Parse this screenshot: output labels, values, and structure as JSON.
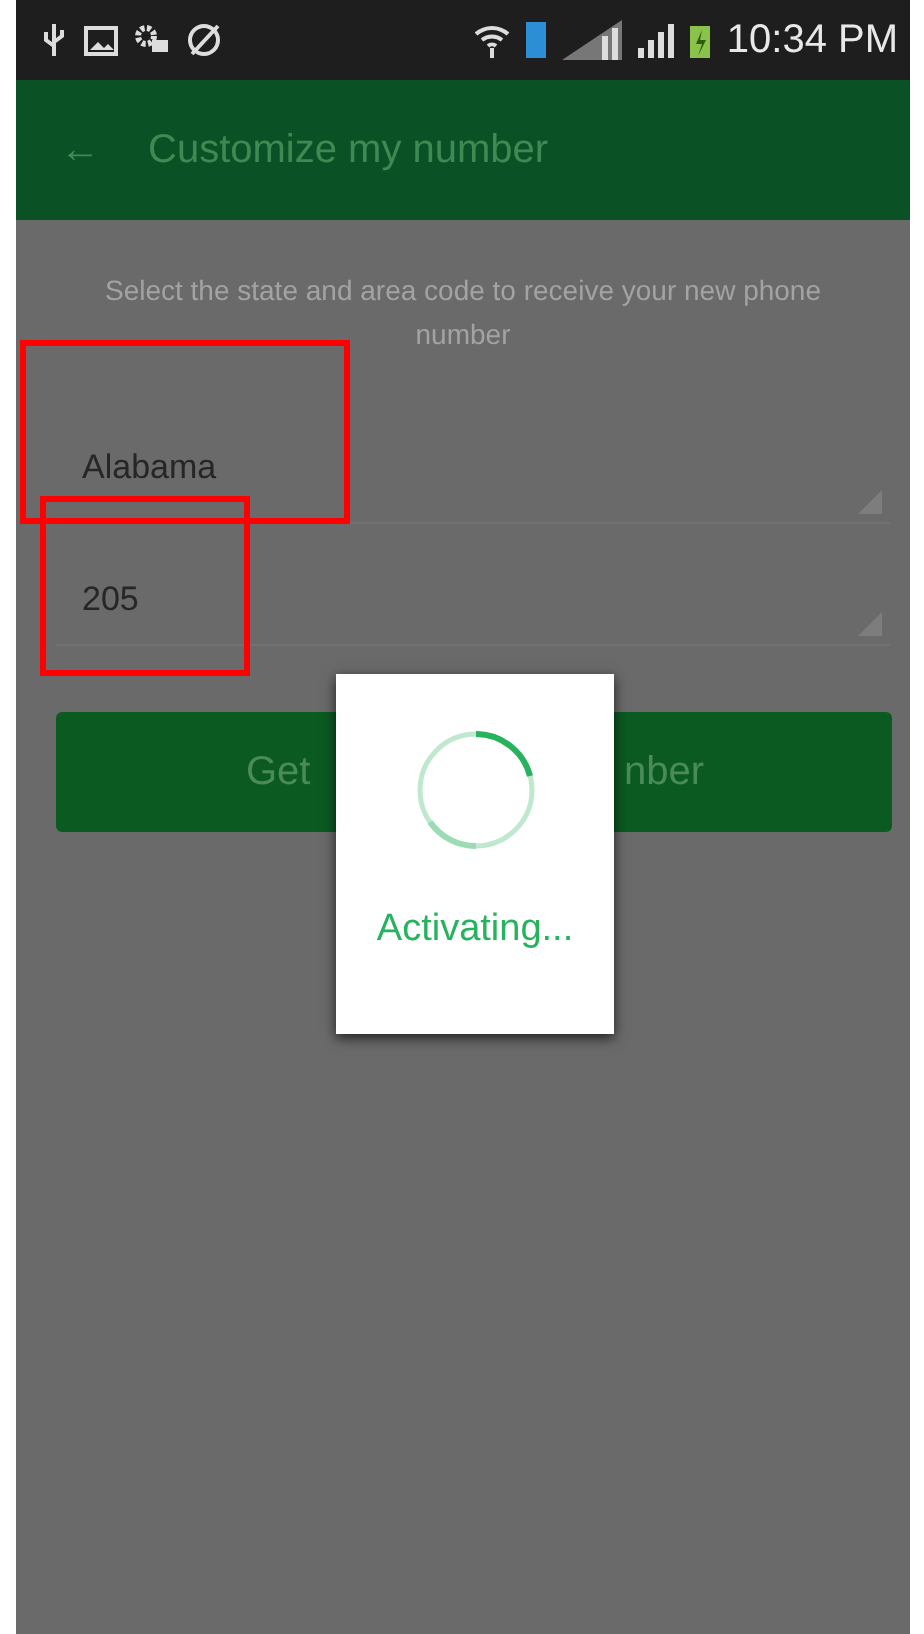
{
  "status_bar": {
    "time": "10:34 PM"
  },
  "app_bar": {
    "back": "←",
    "title": "Customize my number"
  },
  "instruction": "Select the state and area code to receive your new phone number",
  "dropdowns": [
    {
      "value": "Alabama"
    },
    {
      "value": "205"
    }
  ],
  "button": {
    "label_left": "Get",
    "label_right": "nber"
  },
  "dialog": {
    "message": "Activating..."
  },
  "annotations": [
    {
      "kind": "highlight",
      "color": "#ff0000"
    },
    {
      "kind": "highlight",
      "color": "#ff0000"
    }
  ]
}
